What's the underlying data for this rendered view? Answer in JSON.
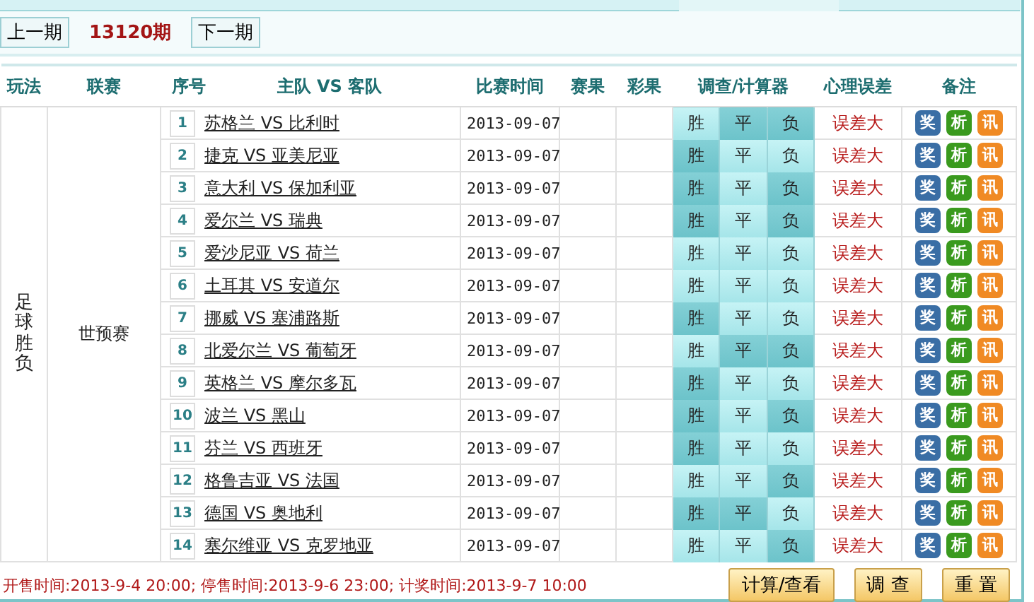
{
  "period_nav": {
    "prev": "上一期",
    "current": "13120期",
    "next": "下一期"
  },
  "columns": [
    "玩法",
    "联赛",
    "序号",
    "主队 VS 客队",
    "比赛时间",
    "赛果",
    "彩果",
    "调查/计算器",
    "心理误差",
    "备注"
  ],
  "play_type": "足球胜负",
  "league": "世预赛",
  "matches": [
    {
      "no": "1",
      "teams": "苏格兰 VS 比利时",
      "time": "2013-09-07",
      "picks": [
        {
          "label": "胜",
          "selected": false
        },
        {
          "label": "平",
          "selected": true
        },
        {
          "label": "负",
          "selected": true
        }
      ],
      "error": "误差大",
      "notes": [
        {
          "label": "奖",
          "color": "#3a6ea5"
        },
        {
          "label": "析",
          "color": "#3a9a1e"
        },
        {
          "label": "讯",
          "color": "#f08a24"
        }
      ]
    },
    {
      "no": "2",
      "teams": "捷克 VS 亚美尼亚",
      "time": "2013-09-07",
      "picks": [
        {
          "label": "胜",
          "selected": true
        },
        {
          "label": "平",
          "selected": false
        },
        {
          "label": "负",
          "selected": false
        }
      ],
      "error": "误差大",
      "notes": [
        {
          "label": "奖",
          "color": "#3a6ea5"
        },
        {
          "label": "析",
          "color": "#3a9a1e"
        },
        {
          "label": "讯",
          "color": "#f08a24"
        }
      ]
    },
    {
      "no": "3",
      "teams": "意大利 VS 保加利亚",
      "time": "2013-09-07",
      "picks": [
        {
          "label": "胜",
          "selected": true
        },
        {
          "label": "平",
          "selected": false
        },
        {
          "label": "负",
          "selected": true
        }
      ],
      "error": "误差大",
      "notes": [
        {
          "label": "奖",
          "color": "#3a6ea5"
        },
        {
          "label": "析",
          "color": "#3a9a1e"
        },
        {
          "label": "讯",
          "color": "#f08a24"
        }
      ]
    },
    {
      "no": "4",
      "teams": "爱尔兰 VS 瑞典",
      "time": "2013-09-07",
      "picks": [
        {
          "label": "胜",
          "selected": true
        },
        {
          "label": "平",
          "selected": false
        },
        {
          "label": "负",
          "selected": true
        }
      ],
      "error": "误差大",
      "notes": [
        {
          "label": "奖",
          "color": "#3a6ea5"
        },
        {
          "label": "析",
          "color": "#3a9a1e"
        },
        {
          "label": "讯",
          "color": "#f08a24"
        }
      ]
    },
    {
      "no": "5",
      "teams": "爱沙尼亚 VS 荷兰",
      "time": "2013-09-07",
      "picks": [
        {
          "label": "胜",
          "selected": false
        },
        {
          "label": "平",
          "selected": false
        },
        {
          "label": "负",
          "selected": false
        }
      ],
      "error": "误差大",
      "notes": [
        {
          "label": "奖",
          "color": "#3a6ea5"
        },
        {
          "label": "析",
          "color": "#3a9a1e"
        },
        {
          "label": "讯",
          "color": "#f08a24"
        }
      ]
    },
    {
      "no": "6",
      "teams": "土耳其 VS 安道尔",
      "time": "2013-09-07",
      "picks": [
        {
          "label": "胜",
          "selected": false
        },
        {
          "label": "平",
          "selected": false
        },
        {
          "label": "负",
          "selected": false
        }
      ],
      "error": "误差大",
      "notes": [
        {
          "label": "奖",
          "color": "#3a6ea5"
        },
        {
          "label": "析",
          "color": "#3a9a1e"
        },
        {
          "label": "讯",
          "color": "#f08a24"
        }
      ]
    },
    {
      "no": "7",
      "teams": "挪威 VS 塞浦路斯",
      "time": "2013-09-07",
      "picks": [
        {
          "label": "胜",
          "selected": true
        },
        {
          "label": "平",
          "selected": false
        },
        {
          "label": "负",
          "selected": false
        }
      ],
      "error": "误差大",
      "notes": [
        {
          "label": "奖",
          "color": "#3a6ea5"
        },
        {
          "label": "析",
          "color": "#3a9a1e"
        },
        {
          "label": "讯",
          "color": "#f08a24"
        }
      ]
    },
    {
      "no": "8",
      "teams": "北爱尔兰 VS 葡萄牙",
      "time": "2013-09-07",
      "picks": [
        {
          "label": "胜",
          "selected": false
        },
        {
          "label": "平",
          "selected": true
        },
        {
          "label": "负",
          "selected": true
        }
      ],
      "error": "误差大",
      "notes": [
        {
          "label": "奖",
          "color": "#3a6ea5"
        },
        {
          "label": "析",
          "color": "#3a9a1e"
        },
        {
          "label": "讯",
          "color": "#f08a24"
        }
      ]
    },
    {
      "no": "9",
      "teams": "英格兰 VS 摩尔多瓦",
      "time": "2013-09-07",
      "picks": [
        {
          "label": "胜",
          "selected": true
        },
        {
          "label": "平",
          "selected": false
        },
        {
          "label": "负",
          "selected": false
        }
      ],
      "error": "误差大",
      "notes": [
        {
          "label": "奖",
          "color": "#3a6ea5"
        },
        {
          "label": "析",
          "color": "#3a9a1e"
        },
        {
          "label": "讯",
          "color": "#f08a24"
        }
      ]
    },
    {
      "no": "10",
      "teams": "波兰 VS 黑山",
      "time": "2013-09-07",
      "picks": [
        {
          "label": "胜",
          "selected": true
        },
        {
          "label": "平",
          "selected": false
        },
        {
          "label": "负",
          "selected": true
        }
      ],
      "error": "误差大",
      "notes": [
        {
          "label": "奖",
          "color": "#3a6ea5"
        },
        {
          "label": "析",
          "color": "#3a9a1e"
        },
        {
          "label": "讯",
          "color": "#f08a24"
        }
      ]
    },
    {
      "no": "11",
      "teams": "芬兰 VS 西班牙",
      "time": "2013-09-07",
      "picks": [
        {
          "label": "胜",
          "selected": true
        },
        {
          "label": "平",
          "selected": false
        },
        {
          "label": "负",
          "selected": false
        }
      ],
      "error": "误差大",
      "notes": [
        {
          "label": "奖",
          "color": "#3a6ea5"
        },
        {
          "label": "析",
          "color": "#3a9a1e"
        },
        {
          "label": "讯",
          "color": "#f08a24"
        }
      ]
    },
    {
      "no": "12",
      "teams": "格鲁吉亚 VS 法国",
      "time": "2013-09-07",
      "picks": [
        {
          "label": "胜",
          "selected": false
        },
        {
          "label": "平",
          "selected": false
        },
        {
          "label": "负",
          "selected": true
        }
      ],
      "error": "误差大",
      "notes": [
        {
          "label": "奖",
          "color": "#3a6ea5"
        },
        {
          "label": "析",
          "color": "#3a9a1e"
        },
        {
          "label": "讯",
          "color": "#f08a24"
        }
      ]
    },
    {
      "no": "13",
      "teams": "德国 VS 奥地利",
      "time": "2013-09-07",
      "picks": [
        {
          "label": "胜",
          "selected": true
        },
        {
          "label": "平",
          "selected": true
        },
        {
          "label": "负",
          "selected": false
        }
      ],
      "error": "误差大",
      "notes": [
        {
          "label": "奖",
          "color": "#3a6ea5"
        },
        {
          "label": "析",
          "color": "#3a9a1e"
        },
        {
          "label": "讯",
          "color": "#f08a24"
        }
      ]
    },
    {
      "no": "14",
      "teams": "塞尔维亚 VS 克罗地亚",
      "time": "2013-09-07",
      "picks": [
        {
          "label": "胜",
          "selected": false
        },
        {
          "label": "平",
          "selected": false
        },
        {
          "label": "负",
          "selected": true
        }
      ],
      "error": "误差大",
      "notes": [
        {
          "label": "奖",
          "color": "#3a6ea5"
        },
        {
          "label": "析",
          "color": "#3a9a1e"
        },
        {
          "label": "讯",
          "color": "#f08a24"
        }
      ]
    }
  ],
  "footer": {
    "info": "开售时间:2013-9-4 20:00; 停售时间:2013-9-6 23:00; 计奖时间:2013-9-7 10:00",
    "buttons": [
      "计算/查看",
      "调 查",
      "重 置"
    ]
  }
}
